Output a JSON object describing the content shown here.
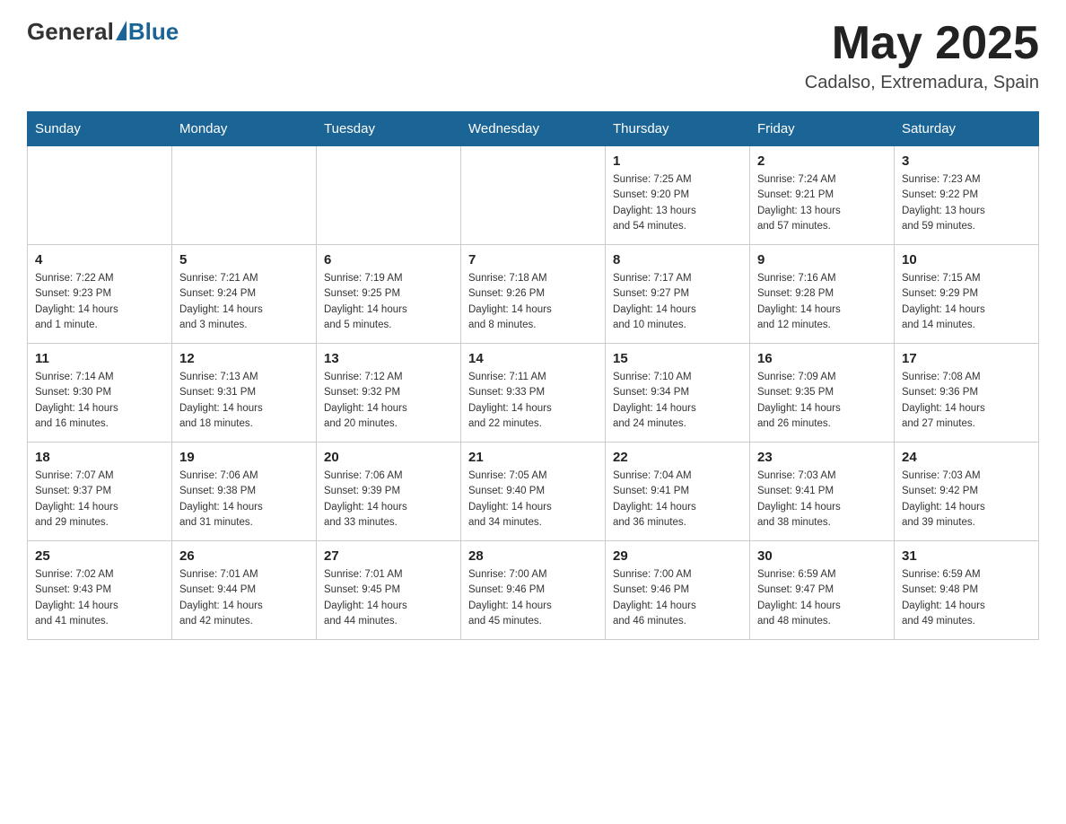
{
  "header": {
    "logo_general": "General",
    "logo_blue": "Blue",
    "main_title": "May 2025",
    "subtitle": "Cadalso, Extremadura, Spain"
  },
  "days_of_week": [
    "Sunday",
    "Monday",
    "Tuesday",
    "Wednesday",
    "Thursday",
    "Friday",
    "Saturday"
  ],
  "weeks": [
    [
      {
        "day": "",
        "info": ""
      },
      {
        "day": "",
        "info": ""
      },
      {
        "day": "",
        "info": ""
      },
      {
        "day": "",
        "info": ""
      },
      {
        "day": "1",
        "info": "Sunrise: 7:25 AM\nSunset: 9:20 PM\nDaylight: 13 hours\nand 54 minutes."
      },
      {
        "day": "2",
        "info": "Sunrise: 7:24 AM\nSunset: 9:21 PM\nDaylight: 13 hours\nand 57 minutes."
      },
      {
        "day": "3",
        "info": "Sunrise: 7:23 AM\nSunset: 9:22 PM\nDaylight: 13 hours\nand 59 minutes."
      }
    ],
    [
      {
        "day": "4",
        "info": "Sunrise: 7:22 AM\nSunset: 9:23 PM\nDaylight: 14 hours\nand 1 minute."
      },
      {
        "day": "5",
        "info": "Sunrise: 7:21 AM\nSunset: 9:24 PM\nDaylight: 14 hours\nand 3 minutes."
      },
      {
        "day": "6",
        "info": "Sunrise: 7:19 AM\nSunset: 9:25 PM\nDaylight: 14 hours\nand 5 minutes."
      },
      {
        "day": "7",
        "info": "Sunrise: 7:18 AM\nSunset: 9:26 PM\nDaylight: 14 hours\nand 8 minutes."
      },
      {
        "day": "8",
        "info": "Sunrise: 7:17 AM\nSunset: 9:27 PM\nDaylight: 14 hours\nand 10 minutes."
      },
      {
        "day": "9",
        "info": "Sunrise: 7:16 AM\nSunset: 9:28 PM\nDaylight: 14 hours\nand 12 minutes."
      },
      {
        "day": "10",
        "info": "Sunrise: 7:15 AM\nSunset: 9:29 PM\nDaylight: 14 hours\nand 14 minutes."
      }
    ],
    [
      {
        "day": "11",
        "info": "Sunrise: 7:14 AM\nSunset: 9:30 PM\nDaylight: 14 hours\nand 16 minutes."
      },
      {
        "day": "12",
        "info": "Sunrise: 7:13 AM\nSunset: 9:31 PM\nDaylight: 14 hours\nand 18 minutes."
      },
      {
        "day": "13",
        "info": "Sunrise: 7:12 AM\nSunset: 9:32 PM\nDaylight: 14 hours\nand 20 minutes."
      },
      {
        "day": "14",
        "info": "Sunrise: 7:11 AM\nSunset: 9:33 PM\nDaylight: 14 hours\nand 22 minutes."
      },
      {
        "day": "15",
        "info": "Sunrise: 7:10 AM\nSunset: 9:34 PM\nDaylight: 14 hours\nand 24 minutes."
      },
      {
        "day": "16",
        "info": "Sunrise: 7:09 AM\nSunset: 9:35 PM\nDaylight: 14 hours\nand 26 minutes."
      },
      {
        "day": "17",
        "info": "Sunrise: 7:08 AM\nSunset: 9:36 PM\nDaylight: 14 hours\nand 27 minutes."
      }
    ],
    [
      {
        "day": "18",
        "info": "Sunrise: 7:07 AM\nSunset: 9:37 PM\nDaylight: 14 hours\nand 29 minutes."
      },
      {
        "day": "19",
        "info": "Sunrise: 7:06 AM\nSunset: 9:38 PM\nDaylight: 14 hours\nand 31 minutes."
      },
      {
        "day": "20",
        "info": "Sunrise: 7:06 AM\nSunset: 9:39 PM\nDaylight: 14 hours\nand 33 minutes."
      },
      {
        "day": "21",
        "info": "Sunrise: 7:05 AM\nSunset: 9:40 PM\nDaylight: 14 hours\nand 34 minutes."
      },
      {
        "day": "22",
        "info": "Sunrise: 7:04 AM\nSunset: 9:41 PM\nDaylight: 14 hours\nand 36 minutes."
      },
      {
        "day": "23",
        "info": "Sunrise: 7:03 AM\nSunset: 9:41 PM\nDaylight: 14 hours\nand 38 minutes."
      },
      {
        "day": "24",
        "info": "Sunrise: 7:03 AM\nSunset: 9:42 PM\nDaylight: 14 hours\nand 39 minutes."
      }
    ],
    [
      {
        "day": "25",
        "info": "Sunrise: 7:02 AM\nSunset: 9:43 PM\nDaylight: 14 hours\nand 41 minutes."
      },
      {
        "day": "26",
        "info": "Sunrise: 7:01 AM\nSunset: 9:44 PM\nDaylight: 14 hours\nand 42 minutes."
      },
      {
        "day": "27",
        "info": "Sunrise: 7:01 AM\nSunset: 9:45 PM\nDaylight: 14 hours\nand 44 minutes."
      },
      {
        "day": "28",
        "info": "Sunrise: 7:00 AM\nSunset: 9:46 PM\nDaylight: 14 hours\nand 45 minutes."
      },
      {
        "day": "29",
        "info": "Sunrise: 7:00 AM\nSunset: 9:46 PM\nDaylight: 14 hours\nand 46 minutes."
      },
      {
        "day": "30",
        "info": "Sunrise: 6:59 AM\nSunset: 9:47 PM\nDaylight: 14 hours\nand 48 minutes."
      },
      {
        "day": "31",
        "info": "Sunrise: 6:59 AM\nSunset: 9:48 PM\nDaylight: 14 hours\nand 49 minutes."
      }
    ]
  ]
}
